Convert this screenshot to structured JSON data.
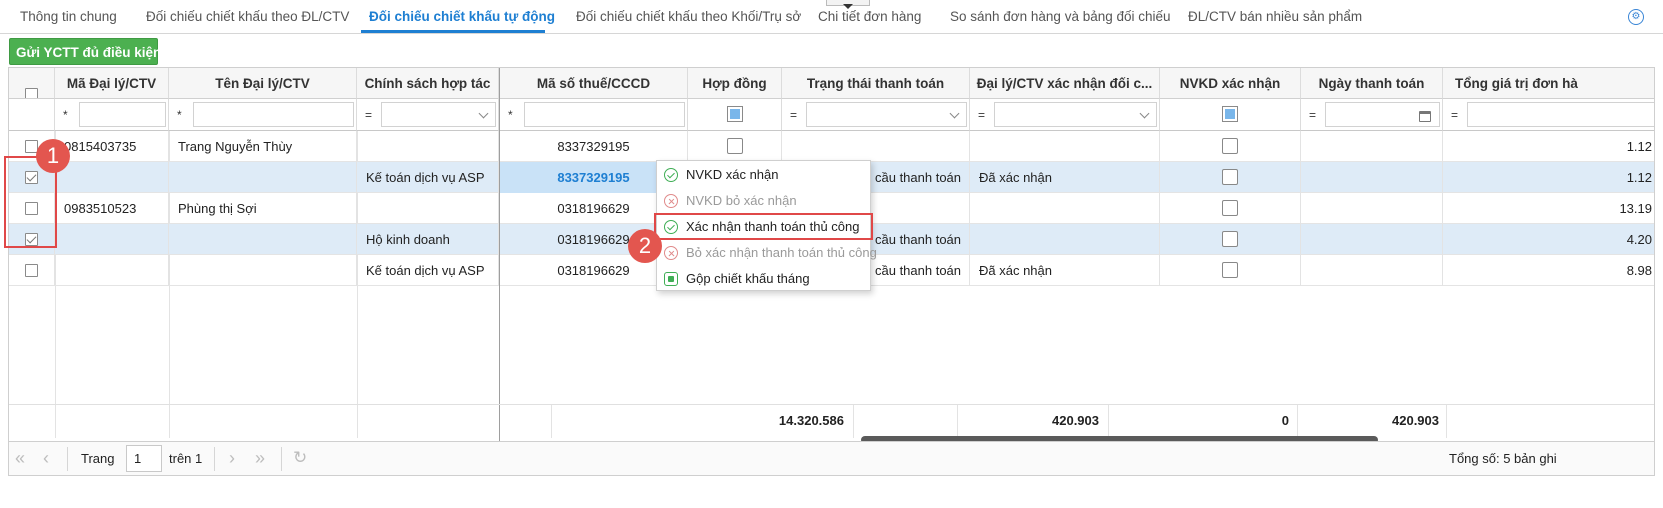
{
  "tabs": [
    {
      "label": "Thông tin chung",
      "active": false
    },
    {
      "label": "Đối chiếu chiết khấu theo ĐL/CTV",
      "active": false
    },
    {
      "label": "Đối chiếu chiết khấu tự động",
      "active": true
    },
    {
      "label": "Đối chiếu chiết khấu theo Khối/Trụ sở",
      "active": false
    },
    {
      "label": "Chi tiết đơn hàng",
      "active": false
    },
    {
      "label": "So sánh đơn hàng và bảng đối chiếu",
      "active": false
    },
    {
      "label": "ĐL/CTV bán nhiều sản phẩm",
      "active": false
    }
  ],
  "toolbar": {
    "send_button": "Gửi YCTT đủ điều kiện"
  },
  "grid": {
    "columns": [
      "Mã Đại lý/CTV",
      "Tên Đại lý/CTV",
      "Chính sách hợp tác",
      "Mã số thuế/CCCD",
      "Hợp đồng",
      "Trạng thái thanh toán",
      "Đại lý/CTV xác nhận đối c...",
      "NVKD xác nhận",
      "Ngày thanh toán",
      "Tổng giá trị đơn hà"
    ],
    "filter_ops": [
      "*",
      "*",
      "=",
      "*",
      "",
      "=",
      "=",
      "",
      "=",
      "="
    ],
    "rows": [
      {
        "selected": false,
        "code": "0815403735",
        "name": "Trang Nguyễn Thùy",
        "policy": "",
        "tax": "8337329195",
        "tax_link": false,
        "status": "",
        "agent_confirm": "",
        "total": "1.12"
      },
      {
        "selected": true,
        "code": "",
        "name": "",
        "policy": "Kế toán dịch vụ ASP",
        "tax": "8337329195",
        "tax_link": true,
        "status": "cầu thanh toán",
        "agent_confirm": "Đã xác nhận",
        "total": "1.12"
      },
      {
        "selected": false,
        "code": "0983510523",
        "name": "Phùng thị Sợi",
        "policy": "",
        "tax": "0318196629",
        "tax_link": false,
        "status": "",
        "agent_confirm": "",
        "total": "13.19"
      },
      {
        "selected": true,
        "code": "",
        "name": "",
        "policy": "Hộ kinh doanh",
        "tax": "0318196629",
        "tax_link": false,
        "status": "cầu thanh toán",
        "agent_confirm": "",
        "total": "4.20"
      },
      {
        "selected": false,
        "code": "",
        "name": "",
        "policy": "Kế toán dịch vụ ASP",
        "tax": "0318196629",
        "tax_link": false,
        "status": "cầu thanh toán",
        "agent_confirm": "Đã xác nhận",
        "total": "8.98"
      }
    ],
    "summary": [
      "14.320.586",
      "420.903",
      "0",
      "420.903"
    ]
  },
  "context_menu": {
    "items": [
      {
        "label": "NVKD xác nhận",
        "icon": "check-circle-icon",
        "enabled": true
      },
      {
        "label": "NVKD bỏ xác nhận",
        "icon": "x-circle-icon",
        "enabled": false
      },
      {
        "label": "Xác nhận thanh toán thủ công",
        "icon": "check-circle-icon",
        "enabled": true
      },
      {
        "label": "Bỏ xác nhận thanh toán thủ công",
        "icon": "x-circle-icon",
        "enabled": false
      },
      {
        "label": "Gộp chiết khấu tháng",
        "icon": "merge-icon",
        "enabled": true
      }
    ]
  },
  "pager": {
    "page_label": "Trang",
    "page_value": "1",
    "of_label": "trên 1",
    "total_label": "Tổng số: 5 bản ghi"
  },
  "annotations": {
    "badge_1": "1",
    "badge_2": "2",
    "color": "#e04848"
  },
  "colors": {
    "accent": "#1e7fd2",
    "button_green": "#4cb050",
    "selected_row": "#deebf7"
  }
}
